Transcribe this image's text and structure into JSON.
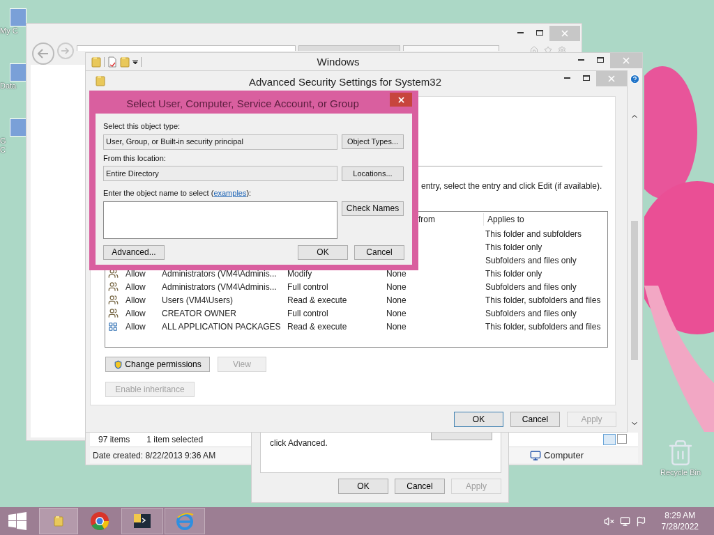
{
  "desktop_icons": [
    {
      "lines": [
        "My C"
      ]
    },
    {
      "lines": [
        "Data"
      ]
    },
    {
      "lines": [
        "G",
        "C"
      ]
    }
  ],
  "recycle_bin": {
    "label": "Recycle Bin"
  },
  "explorer": {
    "title": "Windows",
    "status": {
      "items": "97 items",
      "selected": "1 item selected",
      "date": "Date created: 8/22/2013 9:36 AM",
      "location": "Computer"
    }
  },
  "properties": {
    "text": "click Advanced.",
    "buttons": [
      {
        "label": "OK",
        "disabled": false
      },
      {
        "label": "Cancel",
        "disabled": false
      },
      {
        "label": "Apply",
        "disabled": true
      }
    ]
  },
  "advanced": {
    "title": "Advanced Security Settings for System32",
    "hint": "entry, select the entry and click Edit (if available).",
    "columns": [
      {
        "label": "from"
      },
      {
        "label": "Applies to"
      }
    ],
    "rows": [
      {
        "applies_to": "This folder and subfolders"
      },
      {
        "applies_to": "This folder only"
      },
      {
        "applies_to": "Subfolders and files only"
      },
      {
        "kind": "group",
        "type": "Allow",
        "principal": "Administrators (VM4\\Adminis...",
        "access": "Modify",
        "inherited": "None",
        "applies_to": "This folder only"
      },
      {
        "kind": "group",
        "type": "Allow",
        "principal": "Administrators (VM4\\Adminis...",
        "access": "Full control",
        "inherited": "None",
        "applies_to": "Subfolders and files only"
      },
      {
        "kind": "group",
        "type": "Allow",
        "principal": "Users (VM4\\Users)",
        "access": "Read & execute",
        "inherited": "None",
        "applies_to": "This folder, subfolders and files"
      },
      {
        "kind": "group",
        "type": "Allow",
        "principal": "CREATOR OWNER",
        "access": "Full control",
        "inherited": "None",
        "applies_to": "Subfolders and files only"
      },
      {
        "kind": "package",
        "type": "Allow",
        "principal": "ALL APPLICATION PACKAGES",
        "access": "Read & execute",
        "inherited": "None",
        "applies_to": "This folder, subfolders and files"
      }
    ],
    "change_permissions": {
      "label": "Change permissions",
      "disabled": false
    },
    "view": {
      "label": "View",
      "disabled": true
    },
    "enable_inheritance": {
      "label": "Enable inheritance",
      "disabled": true
    },
    "buttons": [
      {
        "label": "OK",
        "disabled": false,
        "default": true
      },
      {
        "label": "Cancel",
        "disabled": false,
        "default": false
      },
      {
        "label": "Apply",
        "disabled": true,
        "default": false
      }
    ]
  },
  "select_dialog": {
    "title": "Select User, Computer, Service Account, or Group",
    "object_type_label": "Select this object type:",
    "object_type": "User, Group, or Built-in security principal",
    "object_types_button": "Object Types...",
    "location_label": "From this location:",
    "location": "Entire Directory",
    "locations_button": "Locations...",
    "name_label_before": "Enter the object name to select (",
    "name_label_link": "examples",
    "name_label_after": "):",
    "check_names_button": "Check Names",
    "advanced_button": "Advanced...",
    "ok_button": "OK",
    "cancel_button": "Cancel"
  },
  "taskbar": {
    "time": "8:29 AM",
    "date": "7/28/2022"
  }
}
